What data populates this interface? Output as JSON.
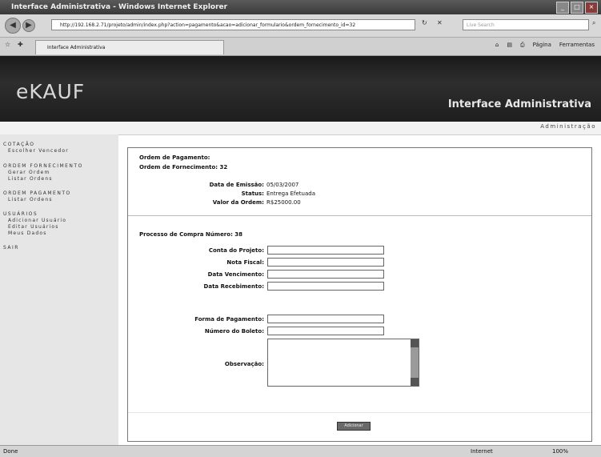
{
  "window": {
    "title": "Interface Administrativa - Windows Internet Explorer"
  },
  "browser": {
    "url": "http://192.168.2.71/projeto/admin/index.php?action=pagamento&acao=adicionar_formulario&ordem_fornecimento_id=32",
    "search_placeholder": "Live Search",
    "tab_label": "Interface Administrativa",
    "tools": [
      "Página",
      "Ferramentas"
    ]
  },
  "banner": {
    "logo": "eKAUF",
    "title": "Interface Administrativa"
  },
  "adminbar": {
    "label": "Administração"
  },
  "sidebar": {
    "sections": [
      {
        "heading": "COTAÇÃO",
        "items": [
          "Escolher Vencedor"
        ]
      },
      {
        "heading": "ORDEM FORNECIMENTO",
        "items": [
          "Gerar Ordem",
          "Listar Ordens"
        ]
      },
      {
        "heading": "ORDEM PAGAMENTO",
        "items": [
          "Listar Ordens"
        ]
      },
      {
        "heading": "USUÁRIOS",
        "items": [
          "Adicionar Usuário",
          "Editar Usuários",
          "Meus Dados"
        ]
      },
      {
        "heading": "SAIR",
        "items": []
      }
    ]
  },
  "content": {
    "heading1": "Ordem de Pagamento:",
    "heading2": "Ordem de Fornecimento: 32",
    "info": [
      {
        "label": "Data de Emissão:",
        "value": "05/03/2007"
      },
      {
        "label": "Status:",
        "value": "Entrega Efetuada"
      },
      {
        "label": "Valor da Ordem:",
        "value": "R$25000.00"
      }
    ],
    "process": "Processo de Compra Número: 38",
    "fields": [
      {
        "label": "Conta do Projeto:",
        "value": ""
      },
      {
        "label": "Nota Fiscal:",
        "value": ""
      },
      {
        "label": "Data Vencimento:",
        "value": ""
      },
      {
        "label": "Data Recebimento:",
        "value": ""
      },
      {
        "label": "Forma de Pagamento:",
        "value": ""
      },
      {
        "label": "Número do Boleto:",
        "value": ""
      }
    ],
    "observacao_label": "Observação:",
    "submit_label": "Adicionar"
  },
  "status": {
    "left": "Done",
    "zone": "Internet",
    "zoom": "100%"
  }
}
